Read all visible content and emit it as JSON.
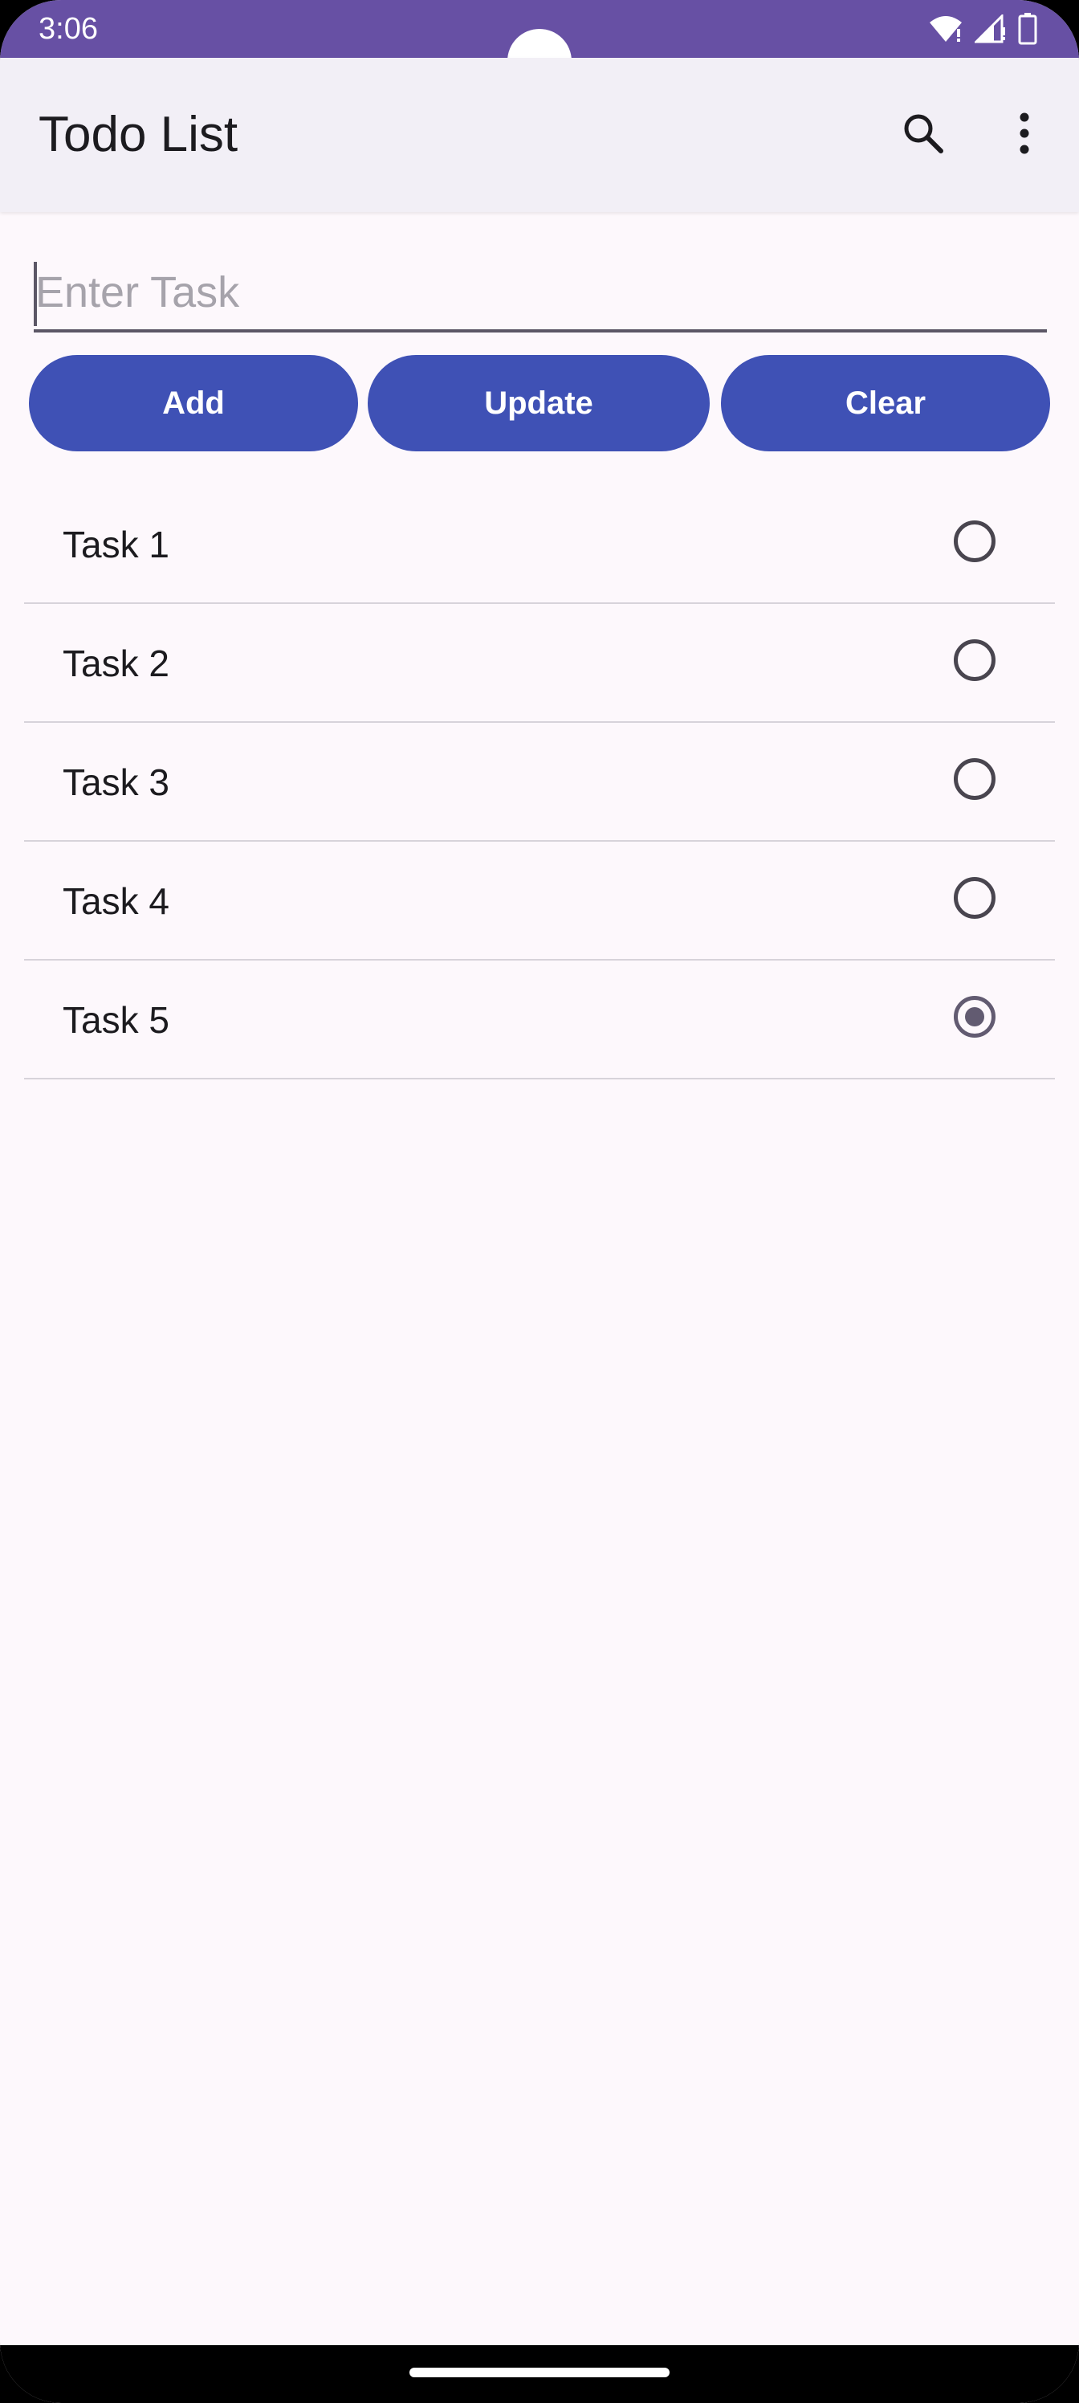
{
  "status_bar": {
    "time": "3:06",
    "icons": [
      "wifi-icon",
      "signal-icon",
      "battery-icon"
    ],
    "color": "#6750a4"
  },
  "app_bar": {
    "title": "Todo List",
    "actions": [
      "search-icon",
      "more-vert-icon"
    ]
  },
  "task_input": {
    "value": "",
    "placeholder": "Enter Task"
  },
  "buttons": {
    "add_label": "Add",
    "update_label": "Update",
    "clear_label": "Clear",
    "color": "#3f51b5"
  },
  "tasks": [
    {
      "label": "Task 1",
      "selected": false
    },
    {
      "label": "Task 2",
      "selected": false
    },
    {
      "label": "Task 3",
      "selected": false
    },
    {
      "label": "Task 4",
      "selected": false
    },
    {
      "label": "Task 5",
      "selected": true
    }
  ]
}
